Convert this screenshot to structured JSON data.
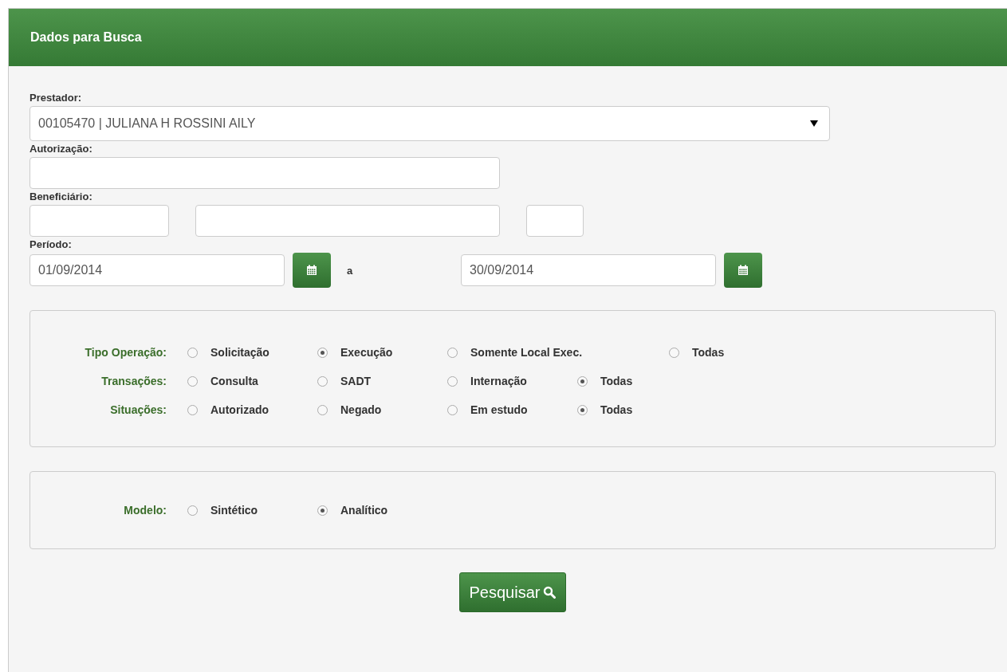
{
  "panel": {
    "title": "Dados para Busca"
  },
  "prestador": {
    "label": "Prestador:",
    "value": "00105470 | JULIANA H ROSSINI AILY"
  },
  "autorizacao": {
    "label": "Autorização:"
  },
  "beneficiario": {
    "label": "Beneficiário:"
  },
  "periodo": {
    "label": "Período:",
    "from": "01/09/2014",
    "separator": "a",
    "to": "30/09/2014"
  },
  "filter_groups": [
    {
      "rows": [
        {
          "label": "Tipo Operação:",
          "options": [
            {
              "label": "Solicitação",
              "selected": false
            },
            {
              "label": "Execução",
              "selected": true
            },
            {
              "label": "Somente Local Exec.",
              "selected": false
            },
            {
              "label": "Todas",
              "selected": false
            }
          ]
        },
        {
          "label": "Transações:",
          "options": [
            {
              "label": "Consulta",
              "selected": false
            },
            {
              "label": "SADT",
              "selected": false
            },
            {
              "label": "Internação",
              "selected": false
            },
            {
              "label": "Todas",
              "selected": true
            }
          ]
        },
        {
          "label": "Situações:",
          "options": [
            {
              "label": "Autorizado",
              "selected": false
            },
            {
              "label": "Negado",
              "selected": false
            },
            {
              "label": "Em estudo",
              "selected": false
            },
            {
              "label": "Todas",
              "selected": true
            }
          ]
        }
      ]
    },
    {
      "rows": [
        {
          "label": "Modelo:",
          "options": [
            {
              "label": "Sintético",
              "selected": false
            },
            {
              "label": "Analítico",
              "selected": true
            }
          ]
        }
      ]
    }
  ],
  "search_button": {
    "label": "Pesquisar"
  }
}
